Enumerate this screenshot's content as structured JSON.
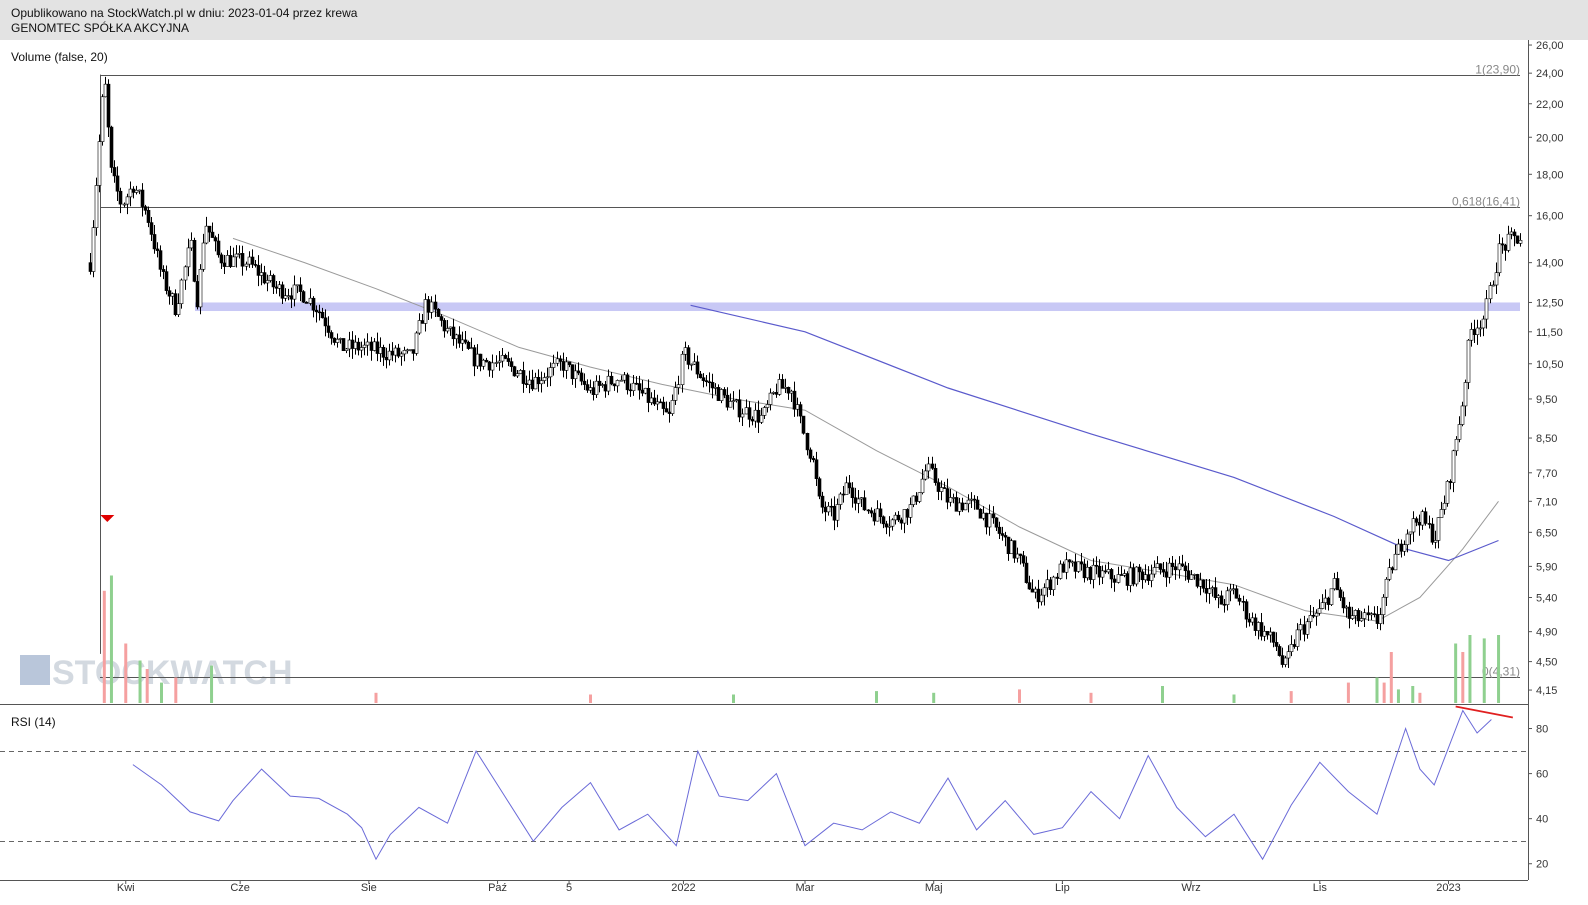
{
  "header": {
    "published": "Opublikowano na StockWatch.pl w dniu: 2023-01-04 przez krewa",
    "company": "GENOMTEC SPÓŁKA AKCYJNA"
  },
  "watermark": "STOCKWATCH",
  "colors": {
    "candle": "#000000",
    "ma_short": "#9a9a9a",
    "ma_long": "#5a5acc",
    "support_band": "#c8c8f5",
    "rsi": "#6a6ad8",
    "vol_up": "#8fd08f",
    "vol_down": "#f5a0a0",
    "arrow": "#e00000",
    "divergence": "#e02020"
  },
  "chart_data": [
    {
      "type": "candlestick",
      "title": "",
      "indicator_label": "Volume (false, 20)",
      "x_ticks": [
        {
          "label": "Kwi",
          "x": 0.025
        },
        {
          "label": "Cze",
          "x": 0.105
        },
        {
          "label": "Sie",
          "x": 0.195
        },
        {
          "label": "Paź",
          "x": 0.285
        },
        {
          "label": "5",
          "x": 0.335
        },
        {
          "label": "2022",
          "x": 0.415
        },
        {
          "label": "Mar",
          "x": 0.5
        },
        {
          "label": "Maj",
          "x": 0.59
        },
        {
          "label": "Lip",
          "x": 0.68
        },
        {
          "label": "Wrz",
          "x": 0.77
        },
        {
          "label": "Lis",
          "x": 0.86
        },
        {
          "label": "2023",
          "x": 0.95
        }
      ],
      "y_ticks": [
        "26,00",
        "24,00",
        "22,00",
        "20,00",
        "18,00",
        "16,00",
        "14,00",
        "12,50",
        "11,50",
        "10,50",
        "9,50",
        "8,50",
        "7,70",
        "7,10",
        "6,50",
        "5,90",
        "5,40",
        "4,90",
        "4,50",
        "4,15"
      ],
      "y_scale": "log",
      "ylim": [
        4.0,
        26.3
      ],
      "fib_levels": [
        {
          "label": "1(23,90)",
          "value": 23.9
        },
        {
          "label": "0,618(16,41)",
          "value": 16.41
        },
        {
          "label": "0(4,31)",
          "value": 4.31
        }
      ],
      "support_band": [
        12.2,
        12.5
      ],
      "close_path": [
        [
          0.0,
          14.0
        ],
        [
          0.01,
          23.9
        ],
        [
          0.015,
          18.0
        ],
        [
          0.022,
          16.5
        ],
        [
          0.03,
          17.5
        ],
        [
          0.04,
          16.0
        ],
        [
          0.05,
          13.5
        ],
        [
          0.06,
          12.3
        ],
        [
          0.07,
          14.8
        ],
        [
          0.075,
          12.5
        ],
        [
          0.08,
          15.8
        ],
        [
          0.09,
          14.2
        ],
        [
          0.11,
          14.0
        ],
        [
          0.13,
          13.0
        ],
        [
          0.15,
          12.8
        ],
        [
          0.16,
          12.2
        ],
        [
          0.175,
          11.0
        ],
        [
          0.19,
          11.0
        ],
        [
          0.21,
          10.8
        ],
        [
          0.225,
          10.7
        ],
        [
          0.235,
          12.5
        ],
        [
          0.25,
          11.5
        ],
        [
          0.27,
          10.6
        ],
        [
          0.29,
          10.5
        ],
        [
          0.31,
          10.0
        ],
        [
          0.33,
          10.5
        ],
        [
          0.35,
          9.7
        ],
        [
          0.37,
          10.1
        ],
        [
          0.39,
          9.5
        ],
        [
          0.405,
          9.0
        ],
        [
          0.415,
          10.8
        ],
        [
          0.43,
          10.0
        ],
        [
          0.45,
          9.3
        ],
        [
          0.47,
          9.0
        ],
        [
          0.48,
          9.8
        ],
        [
          0.49,
          9.8
        ],
        [
          0.5,
          8.5
        ],
        [
          0.505,
          8.0
        ],
        [
          0.51,
          7.0
        ],
        [
          0.52,
          6.8
        ],
        [
          0.53,
          7.5
        ],
        [
          0.54,
          7.0
        ],
        [
          0.56,
          6.7
        ],
        [
          0.575,
          7.0
        ],
        [
          0.585,
          7.8
        ],
        [
          0.6,
          7.1
        ],
        [
          0.62,
          7.0
        ],
        [
          0.635,
          6.5
        ],
        [
          0.65,
          6.0
        ],
        [
          0.66,
          5.4
        ],
        [
          0.67,
          5.6
        ],
        [
          0.68,
          5.9
        ],
        [
          0.7,
          5.8
        ],
        [
          0.72,
          5.7
        ],
        [
          0.74,
          5.8
        ],
        [
          0.76,
          5.9
        ],
        [
          0.78,
          5.6
        ],
        [
          0.79,
          5.3
        ],
        [
          0.8,
          5.5
        ],
        [
          0.81,
          5.1
        ],
        [
          0.82,
          4.9
        ],
        [
          0.83,
          4.7
        ],
        [
          0.835,
          4.4
        ],
        [
          0.845,
          4.9
        ],
        [
          0.86,
          5.2
        ],
        [
          0.87,
          5.6
        ],
        [
          0.88,
          5.1
        ],
        [
          0.9,
          5.05
        ],
        [
          0.91,
          5.9
        ],
        [
          0.92,
          6.5
        ],
        [
          0.93,
          6.8
        ],
        [
          0.94,
          6.4
        ],
        [
          0.95,
          7.5
        ],
        [
          0.96,
          9.5
        ],
        [
          0.965,
          11.5
        ],
        [
          0.975,
          12.0
        ],
        [
          0.985,
          14.5
        ],
        [
          0.995,
          15.0
        ]
      ],
      "ma_short_path": [
        [
          0.1,
          15.0
        ],
        [
          0.15,
          14.0
        ],
        [
          0.2,
          13.0
        ],
        [
          0.25,
          12.0
        ],
        [
          0.3,
          11.0
        ],
        [
          0.35,
          10.4
        ],
        [
          0.4,
          9.9
        ],
        [
          0.45,
          9.5
        ],
        [
          0.5,
          9.2
        ],
        [
          0.55,
          8.2
        ],
        [
          0.6,
          7.4
        ],
        [
          0.65,
          6.6
        ],
        [
          0.7,
          6.0
        ],
        [
          0.75,
          5.8
        ],
        [
          0.8,
          5.6
        ],
        [
          0.85,
          5.2
        ],
        [
          0.9,
          5.05
        ],
        [
          0.93,
          5.4
        ],
        [
          0.96,
          6.2
        ],
        [
          0.985,
          7.1
        ]
      ],
      "ma_long_path": [
        [
          0.42,
          12.4
        ],
        [
          0.5,
          11.5
        ],
        [
          0.6,
          9.8
        ],
        [
          0.7,
          8.6
        ],
        [
          0.8,
          7.6
        ],
        [
          0.87,
          6.8
        ],
        [
          0.92,
          6.2
        ],
        [
          0.95,
          6.0
        ],
        [
          0.985,
          6.35
        ]
      ],
      "volume_up": [
        [
          0.015,
          0.75
        ],
        [
          0.035,
          0.25
        ],
        [
          0.05,
          0.12
        ],
        [
          0.085,
          0.22
        ],
        [
          0.45,
          0.05
        ],
        [
          0.55,
          0.07
        ],
        [
          0.59,
          0.06
        ],
        [
          0.75,
          0.1
        ],
        [
          0.8,
          0.05
        ],
        [
          0.9,
          0.15
        ],
        [
          0.915,
          0.08
        ],
        [
          0.925,
          0.1
        ],
        [
          0.955,
          0.35
        ],
        [
          0.965,
          0.4
        ],
        [
          0.975,
          0.38
        ],
        [
          0.985,
          0.4
        ]
      ],
      "volume_down": [
        [
          0.01,
          0.66
        ],
        [
          0.025,
          0.35
        ],
        [
          0.04,
          0.2
        ],
        [
          0.06,
          0.15
        ],
        [
          0.2,
          0.06
        ],
        [
          0.35,
          0.05
        ],
        [
          0.65,
          0.08
        ],
        [
          0.7,
          0.06
        ],
        [
          0.84,
          0.07
        ],
        [
          0.88,
          0.12
        ],
        [
          0.905,
          0.12
        ],
        [
          0.91,
          0.3
        ],
        [
          0.93,
          0.06
        ],
        [
          0.96,
          0.3
        ]
      ],
      "high_volume_marker_x": 0.01
    },
    {
      "type": "line",
      "title": "",
      "indicator_label": "RSI (14)",
      "y_ticks": [
        "80",
        "60",
        "40",
        "20"
      ],
      "ylim": [
        15,
        90
      ],
      "levels": [
        70,
        30
      ],
      "series": [
        {
          "name": "RSI (14)",
          "points": [
            [
              0.03,
              64
            ],
            [
              0.05,
              55
            ],
            [
              0.07,
              43
            ],
            [
              0.09,
              39
            ],
            [
              0.1,
              48
            ],
            [
              0.12,
              62
            ],
            [
              0.14,
              50
            ],
            [
              0.16,
              49
            ],
            [
              0.18,
              42
            ],
            [
              0.19,
              36
            ],
            [
              0.2,
              22
            ],
            [
              0.21,
              33
            ],
            [
              0.23,
              45
            ],
            [
              0.25,
              38
            ],
            [
              0.27,
              70
            ],
            [
              0.29,
              50
            ],
            [
              0.31,
              30
            ],
            [
              0.33,
              45
            ],
            [
              0.35,
              56
            ],
            [
              0.37,
              35
            ],
            [
              0.39,
              42
            ],
            [
              0.41,
              28
            ],
            [
              0.425,
              70
            ],
            [
              0.44,
              50
            ],
            [
              0.46,
              48
            ],
            [
              0.48,
              60
            ],
            [
              0.5,
              28
            ],
            [
              0.52,
              38
            ],
            [
              0.54,
              35
            ],
            [
              0.56,
              43
            ],
            [
              0.58,
              38
            ],
            [
              0.6,
              58
            ],
            [
              0.62,
              35
            ],
            [
              0.64,
              48
            ],
            [
              0.66,
              33
            ],
            [
              0.68,
              36
            ],
            [
              0.7,
              52
            ],
            [
              0.72,
              40
            ],
            [
              0.74,
              68
            ],
            [
              0.76,
              45
            ],
            [
              0.78,
              32
            ],
            [
              0.8,
              42
            ],
            [
              0.82,
              22
            ],
            [
              0.84,
              46
            ],
            [
              0.86,
              65
            ],
            [
              0.88,
              52
            ],
            [
              0.9,
              42
            ],
            [
              0.92,
              80
            ],
            [
              0.93,
              62
            ],
            [
              0.94,
              55
            ],
            [
              0.96,
              88
            ],
            [
              0.97,
              78
            ],
            [
              0.98,
              84
            ]
          ]
        }
      ],
      "divergence_line": [
        [
          0.955,
          88
        ],
        [
          0.995,
          84
        ]
      ]
    }
  ]
}
